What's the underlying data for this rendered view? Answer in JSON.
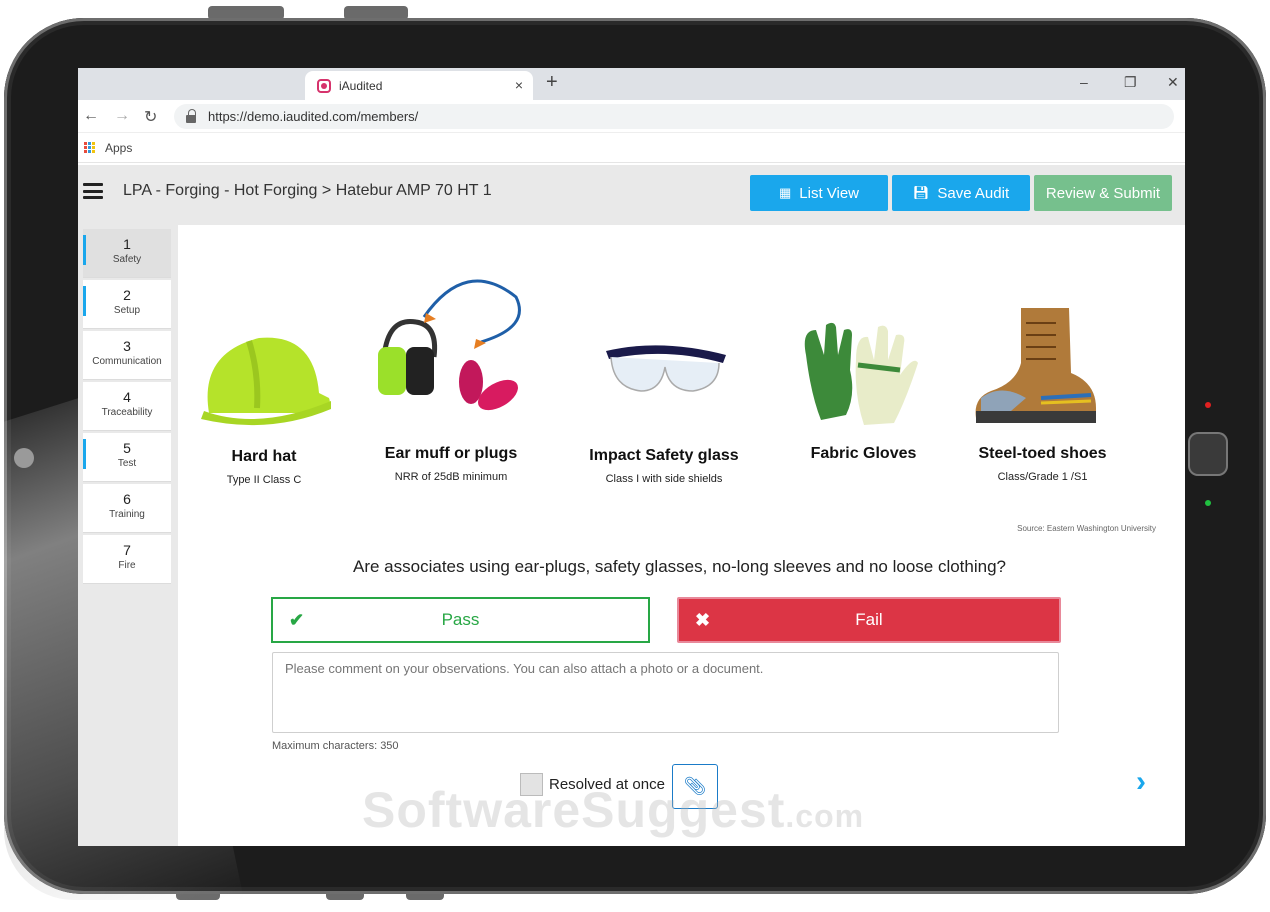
{
  "browser": {
    "tab_title": "iAudited",
    "tab_close": "×",
    "new_tab": "+",
    "url": "https://demo.iaudited.com/members/",
    "bookmark_apps": "Apps",
    "win_minimize": "–",
    "win_maximize": "❐",
    "win_close": "✕",
    "back": "←",
    "forward": "→",
    "reload": "↻"
  },
  "header": {
    "title": "LPA - Forging - Hot Forging > Hatebur AMP 70 HT 1",
    "list_view": "List View",
    "save_audit": "Save Audit",
    "review_submit": "Review & Submit"
  },
  "steps": [
    {
      "num": "1",
      "label": "Safety"
    },
    {
      "num": "2",
      "label": "Setup"
    },
    {
      "num": "3",
      "label": "Communication"
    },
    {
      "num": "4",
      "label": "Traceability"
    },
    {
      "num": "5",
      "label": "Test"
    },
    {
      "num": "6",
      "label": "Training"
    },
    {
      "num": "7",
      "label": "Fire"
    }
  ],
  "ppe": [
    {
      "name": "Hard hat",
      "sub": "Type II Class C"
    },
    {
      "name": "Ear muff or plugs",
      "sub": "NRR of 25dB minimum"
    },
    {
      "name": "Impact Safety glass",
      "sub": "Class I with side shields"
    },
    {
      "name": "Fabric Gloves",
      "sub": ""
    },
    {
      "name": "Steel-toed shoes",
      "sub": "Class/Grade 1 /S1"
    }
  ],
  "source": "Source: Eastern Washington University",
  "question": "Are associates using ear-plugs, safety glasses, no-long sleeves and no loose clothing?",
  "pass_label": "Pass",
  "fail_label": "Fail",
  "comment_placeholder": "Please comment on your observations. You can also attach a photo or a document.",
  "max_chars": "Maximum characters: 350",
  "resolved_label": "Resolved at once",
  "watermark": {
    "main": "SoftwareSuggest",
    "suffix": ".com"
  },
  "colors": {
    "accent_blue": "#1aa7ec",
    "pass_green": "#28a745",
    "fail_red": "#dc3545",
    "submit_green": "#76c08d"
  }
}
